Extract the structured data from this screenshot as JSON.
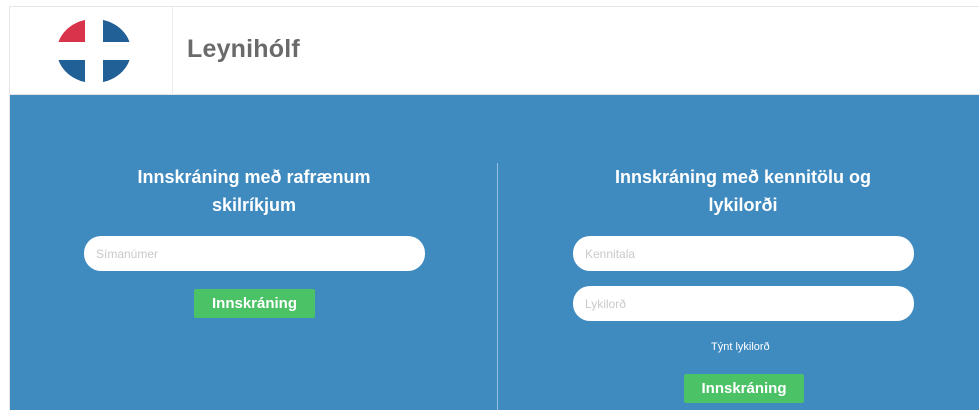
{
  "header": {
    "brand": "Leynihólf",
    "logo_colors": {
      "red": "#d8334a",
      "blue": "#215f97"
    }
  },
  "left_panel": {
    "title_line1": "Innskráning með rafrænum",
    "title_line2": "skilríkjum",
    "phone_placeholder": "Símanúmer",
    "login_button": "Innskráning"
  },
  "right_panel": {
    "title_line1": "Innskráning með kennitölu og",
    "title_line2": "lykilorði",
    "kennitala_placeholder": "Kennitala",
    "password_placeholder": "Lykilorð",
    "forgot_password": "Týnt lykilorð",
    "login_button": "Innskráning"
  },
  "colors": {
    "background": "#3f8bc0",
    "button": "#4cc267",
    "brand_text": "#6a6a6a"
  }
}
